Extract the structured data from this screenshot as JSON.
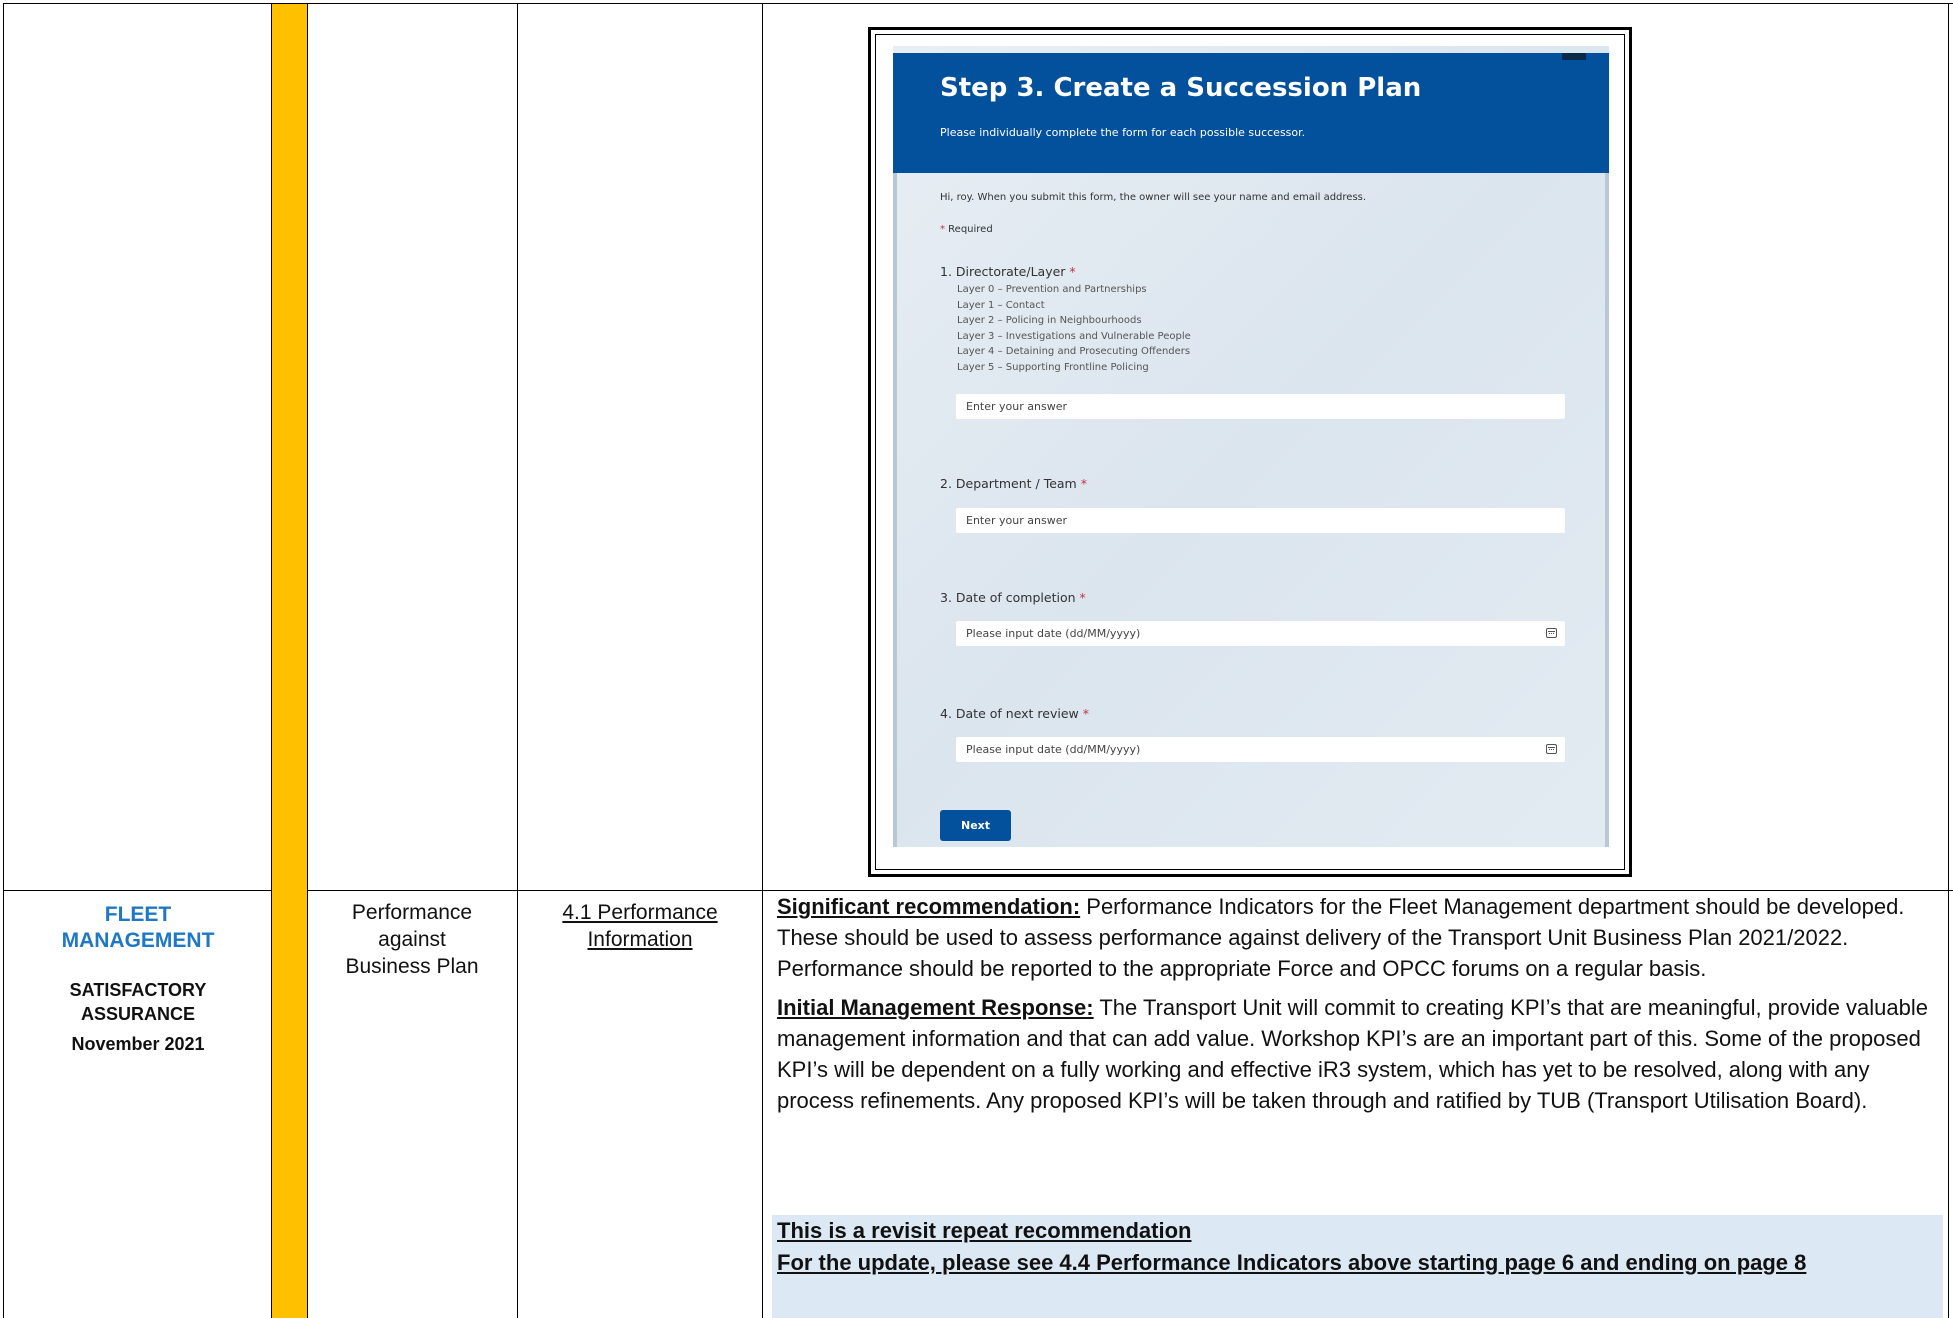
{
  "row2": {
    "area_title_line1": "FLEET",
    "area_title_line2": "MANAGEMENT",
    "assurance_line1": "SATISFACTORY",
    "assurance_line2": "ASSURANCE",
    "date": "November 2021",
    "topic_line1": "Performance",
    "topic_line2": "against",
    "topic_line3": "Business Plan",
    "ref_line1": "4.1 Performance",
    "ref_line2": "Information",
    "sig_label": "Significant recommendation:",
    "sig_text": " Performance Indicators for the Fleet Management department should be developed. These should be used to assess performance against delivery of the Transport Unit Business Plan 2021/2022. Performance should be reported to the appropriate Force and OPCC forums on a regular basis.",
    "resp_label": "Initial Management Response:",
    "resp_text": " The Transport Unit will commit to creating KPI’s that are meaningful, provide valuable management information and that can add value. Workshop KPI’s are an important part of this. Some of the proposed KPI’s will be dependent on a fully working and effective iR3 system, which has yet to be resolved, along with any process refinements. Any proposed KPI’s will be taken through and ratified by TUB (Transport Utilisation Board).",
    "revisit_line1": "This is a revisit repeat recommendation",
    "revisit_line2": "For the update, please see 4.4 Performance Indicators above starting page 6 and ending on page 8"
  },
  "rag_color": "#FFC000",
  "form": {
    "title": "Step 3. Create a Succession Plan",
    "subtitle": "Please individually complete the form for each possible successor.",
    "notice": "Hi, roy. When you submit this form, the owner will see your name and email address.",
    "required_star": "*",
    "required_label": " Required",
    "q1_label": "1. Directorate/Layer",
    "q1_options": [
      "Layer 0 – Prevention and Partnerships",
      "Layer 1 – Contact",
      "Layer 2 – Policing in Neighbourhoods",
      "Layer 3 – Investigations and Vulnerable People",
      "Layer 4 – Detaining and Prosecuting Offenders",
      "Layer 5 – Supporting Frontline Policing"
    ],
    "q1_placeholder": "Enter your answer",
    "q2_label": "2. Department /  Team",
    "q2_placeholder": "Enter your answer",
    "q3_label": "3. Date of completion ",
    "q3_placeholder": "Please input date (dd/MM/yyyy)",
    "q4_label": "4. Date of next review ",
    "q4_placeholder": "Please input date (dd/MM/yyyy)",
    "star": "*",
    "next_label": "Next",
    "header_color": "#03509C"
  }
}
